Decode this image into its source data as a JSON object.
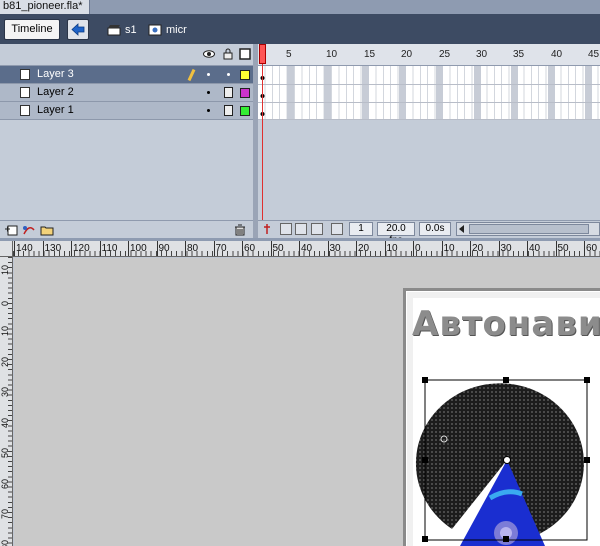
{
  "document": {
    "tab_title": "b81_pioneer.fla*"
  },
  "editbar": {
    "timeline_label": "Timeline",
    "breadcrumbs": [
      {
        "label": "s1",
        "icon": "clapper-icon"
      },
      {
        "label": "micr",
        "icon": "movieclip-icon"
      }
    ]
  },
  "layers": [
    {
      "name": "Layer 3",
      "selected": true,
      "color": "#ffff33",
      "editing": true
    },
    {
      "name": "Layer 2",
      "selected": false,
      "color": "#cc33cc",
      "editing": false
    },
    {
      "name": "Layer 1",
      "selected": false,
      "color": "#33ee33",
      "editing": false
    }
  ],
  "frame_ruler": [
    "1",
    "5",
    "10",
    "15",
    "20",
    "25",
    "30",
    "35",
    "40",
    "45"
  ],
  "status": {
    "current_frame": "1",
    "fps": "20.0 fps",
    "elapsed": "0.0s"
  },
  "hruler_labels": [
    "140",
    "130",
    "120",
    "110",
    "100",
    "90",
    "80",
    "70",
    "60",
    "50",
    "40",
    "30",
    "20",
    "10",
    "0",
    "10",
    "20",
    "30",
    "40",
    "50",
    "60"
  ],
  "vruler_labels": [
    "10",
    "0",
    "10",
    "20",
    "30",
    "40",
    "50",
    "60",
    "70",
    "80"
  ],
  "stage": {
    "logo_text": "Автонавигация"
  },
  "colors": {
    "accent": "#5b6d8b",
    "playhead": "#e03030"
  }
}
